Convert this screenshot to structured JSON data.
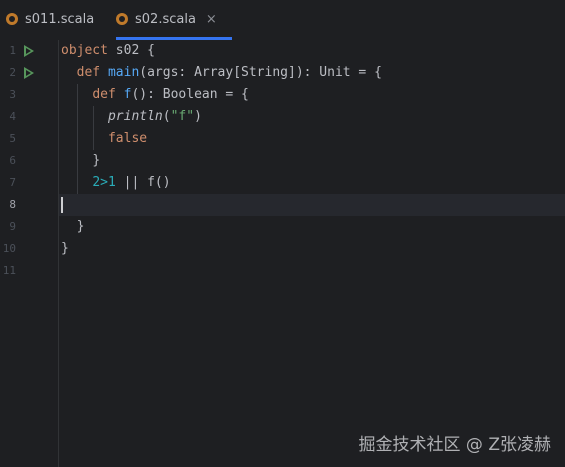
{
  "tabs": [
    {
      "label": "s011.scala",
      "active": false,
      "icon": "scala-object-icon"
    },
    {
      "label": "s02.scala",
      "active": true,
      "icon": "scala-object-icon",
      "close": "×"
    }
  ],
  "gutter": {
    "line_numbers": [
      "1",
      "2",
      "3",
      "4",
      "5",
      "6",
      "7",
      "8",
      "9",
      "10",
      "11"
    ],
    "current_line": "8",
    "run_icons_on_lines": [
      "1",
      "2"
    ]
  },
  "code": {
    "line1": {
      "kw": "object",
      "rest": " s02 {"
    },
    "line2": {
      "kw": "def",
      "fn": "main",
      "rest": "(args: Array[String]): Unit = {"
    },
    "line3": {
      "kw": "def",
      "fn": "f",
      "rest": "(): Boolean = {"
    },
    "line4": {
      "call": "println",
      "open": "(",
      "str": "\"f\"",
      "close": ")"
    },
    "line5": {
      "kw": "false"
    },
    "line6": {
      "text": "}"
    },
    "line7": {
      "num1": "2",
      "op": ">",
      "num2": "1",
      "rest": " || f()"
    },
    "line8": {
      "text": ""
    },
    "line9": {
      "text": "}"
    },
    "line10": {
      "text": "}"
    }
  },
  "colors": {
    "background": "#1e1f22",
    "keyword": "#cf8e6d",
    "function": "#56a8f5",
    "string": "#6aab73",
    "number": "#2aacb8",
    "accent": "#3574f0",
    "run": "#57965c"
  },
  "watermark": "掘金技术社区 @ Z张凌赫"
}
